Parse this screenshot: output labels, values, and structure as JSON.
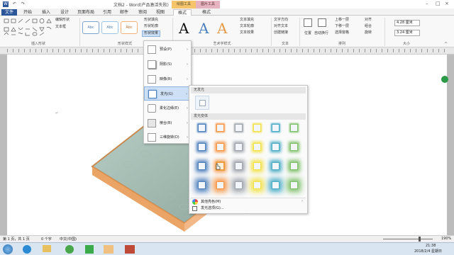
{
  "title": {
    "text": "文档2 - Word(产品激活失败)",
    "context_group_drawing": "绘图工具",
    "context_group_picture": "图片工具"
  },
  "tabs": [
    {
      "label": "文件"
    },
    {
      "label": "开始"
    },
    {
      "label": "插入"
    },
    {
      "label": "设计"
    },
    {
      "label": "页面布局"
    },
    {
      "label": "引用"
    },
    {
      "label": "邮件"
    },
    {
      "label": "审阅"
    },
    {
      "label": "视图"
    },
    {
      "label": "格式"
    },
    {
      "label": "格式"
    }
  ],
  "ribbon": {
    "insert_shapes": {
      "edit_shape": "编辑形状",
      "text_box": "文本框",
      "label": "插入形状"
    },
    "shape_styles": {
      "fill": "形状填充",
      "outline": "形状轮廓",
      "effects": "形状效果",
      "label": "形状样式",
      "preset_abc": "Abc"
    },
    "wordart": {
      "letters": [
        "A",
        "A",
        "A"
      ],
      "text_fill": "文本填充",
      "text_outline": "文本轮廓",
      "text_effects": "文本效果",
      "label": "艺术字样式"
    },
    "text": {
      "direction": "文字方向",
      "align": "对齐文本",
      "link": "创建链接",
      "label": "文本"
    },
    "arrange": {
      "position": "位置",
      "wrap": "自动换行",
      "forward": "上移一层",
      "backward": "下移一层",
      "selection": "选择窗格",
      "align": "对齐",
      "group": "组合",
      "rotate": "旋转",
      "label": "排列"
    },
    "size": {
      "height": "4.28 厘米",
      "width": "3.24 厘米",
      "label": "大小"
    }
  },
  "effects_menu": {
    "items": [
      {
        "label": "预设(P)"
      },
      {
        "label": "阴影(S)"
      },
      {
        "label": "映像(R)"
      },
      {
        "label": "发光(G)"
      },
      {
        "label": "柔化边缘(E)"
      },
      {
        "label": "棱台(B)"
      },
      {
        "label": "三维旋转(D)"
      }
    ]
  },
  "glow_submenu": {
    "no_glow": "无发光",
    "variants": "发光变体",
    "more_colors": "其他亮色(M)",
    "options": "发光选项(G)...",
    "colors": [
      "#4f81bd",
      "#f79646",
      "#9fa5ad",
      "#f2e24a",
      "#4bacc6",
      "#7fc06a"
    ]
  },
  "status": {
    "page": "第 1 页，共 1 页",
    "words": "0 个字",
    "lang": "中文(中国)",
    "zoom": "190%"
  },
  "taskbar": {
    "time": "21:38",
    "date": "2018/2/4 星期日"
  }
}
